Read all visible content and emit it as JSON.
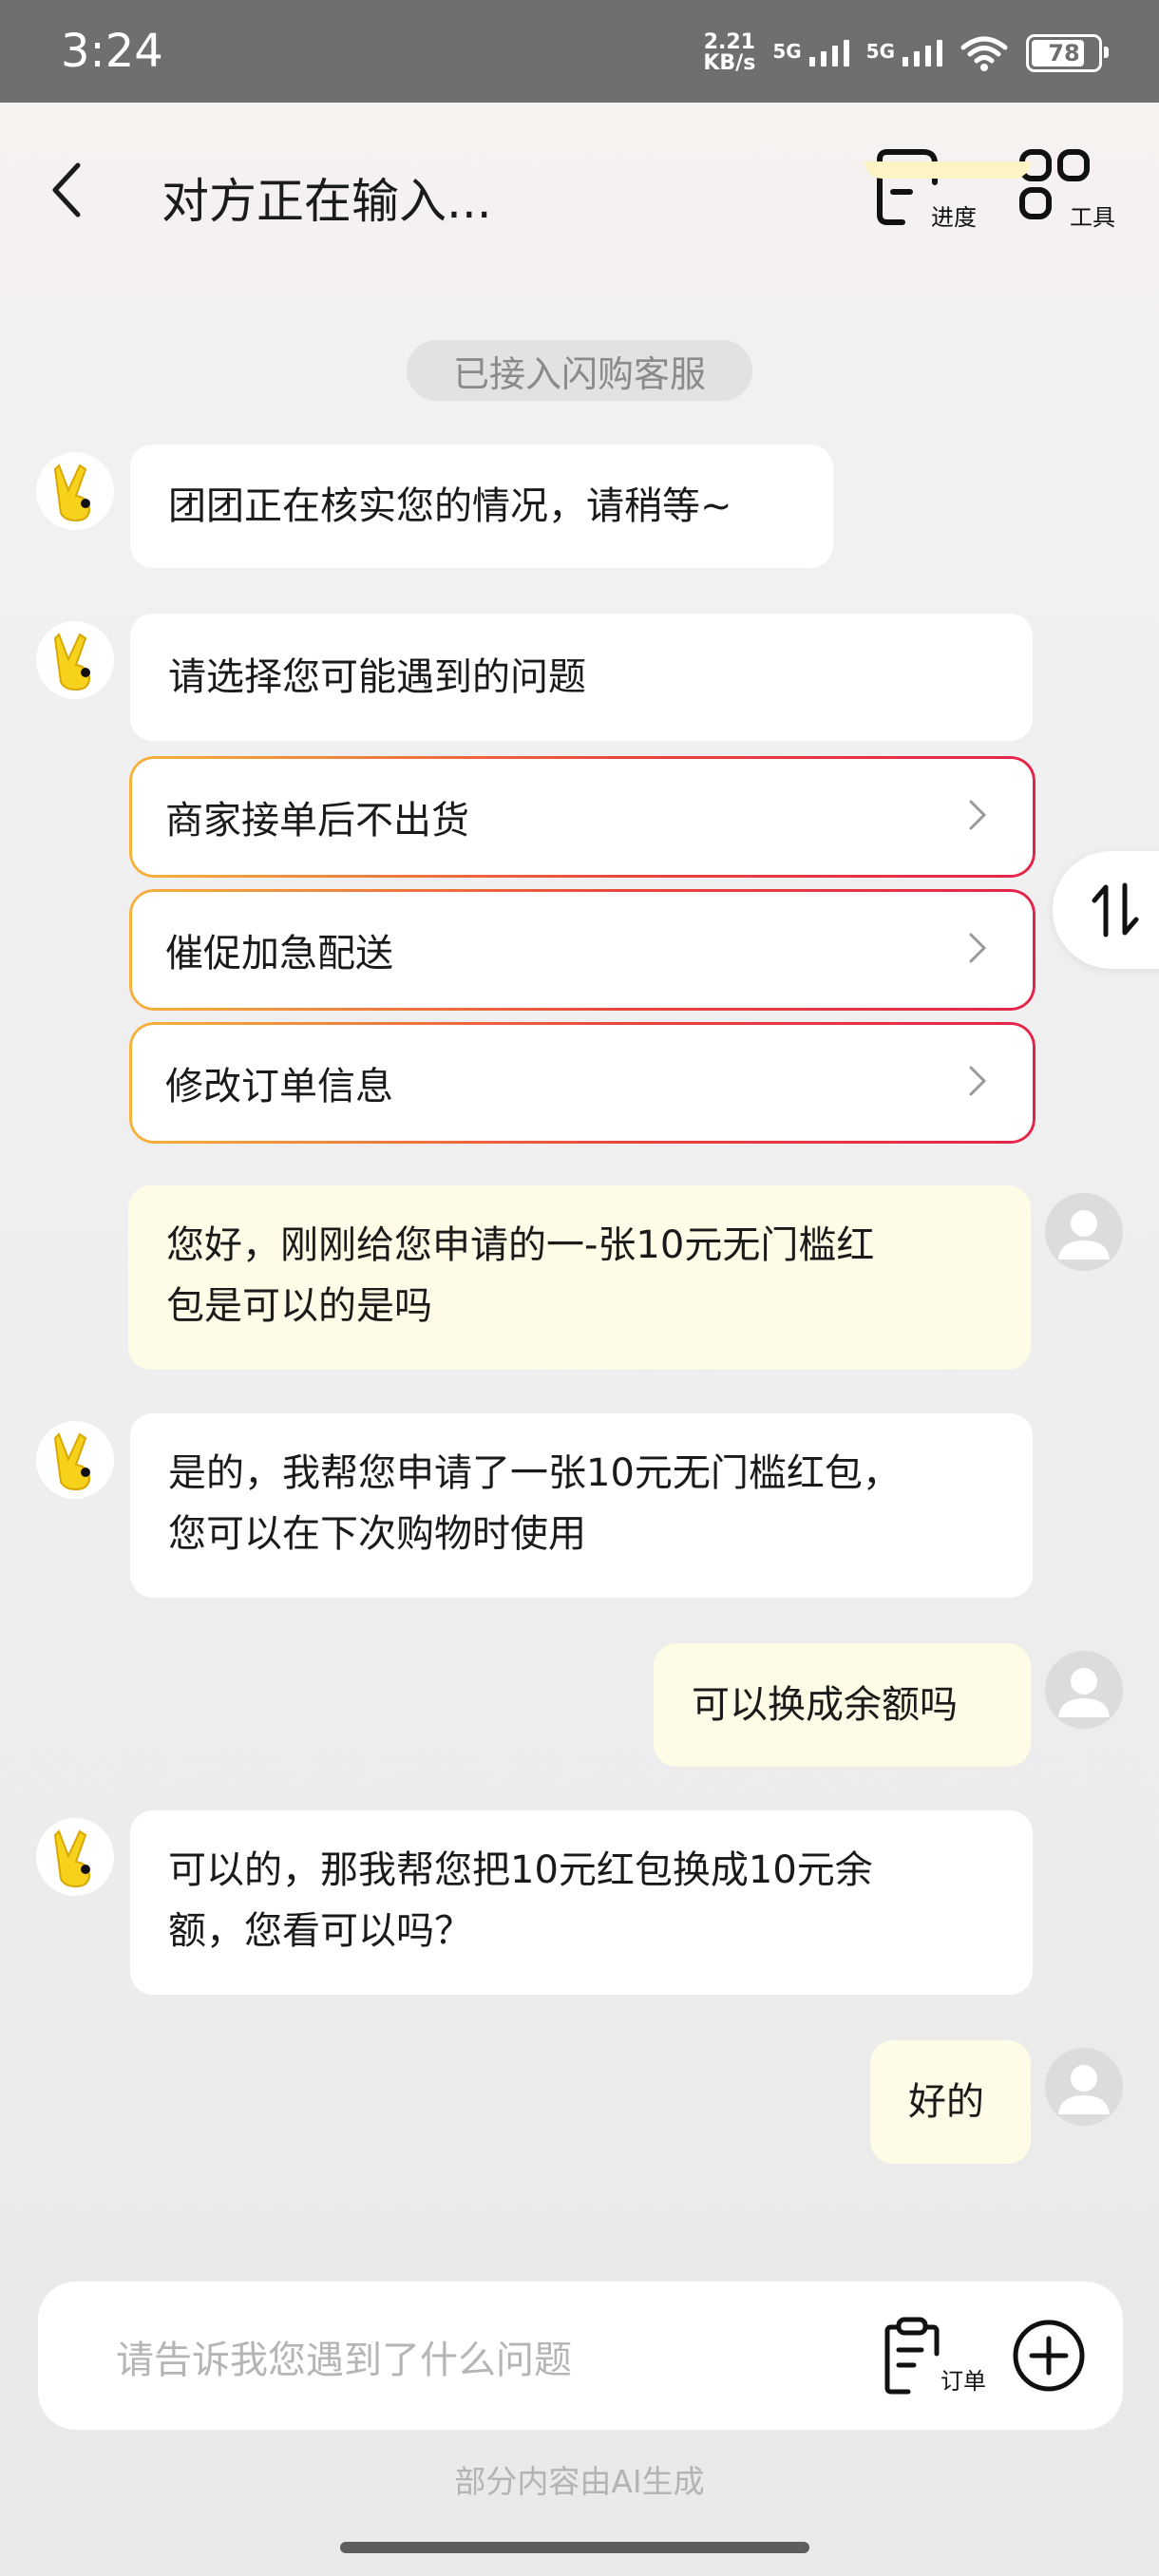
{
  "status_bar": {
    "time": "3:24",
    "speed_value": "2.21",
    "speed_unit": "KB/s",
    "sim1": "5G",
    "sim2": "5G",
    "battery": "78"
  },
  "header": {
    "title": "对方正在输入...",
    "progress_label": "进度",
    "tools_label": "工具"
  },
  "system_chip": "已接入闪购客服",
  "messages": [
    {
      "sender": "bot",
      "text": "团团正在核实您的情况，请稍等~"
    },
    {
      "sender": "bot",
      "text": "请选择您可能遇到的问题"
    },
    {
      "sender": "user",
      "lines": [
        "您好，刚刚给您申请的一-张10元无门槛红",
        "包是可以的是吗"
      ]
    },
    {
      "sender": "bot",
      "lines": [
        "是的，我帮您申请了一张10元无门槛红包，",
        "您可以在下次购物时使用"
      ]
    },
    {
      "sender": "user",
      "text": "可以换成余额吗"
    },
    {
      "sender": "bot",
      "lines": [
        "可以的，那我帮您把10元红包换成10元余",
        "额，您看可以吗？"
      ]
    },
    {
      "sender": "user",
      "text": "好的"
    }
  ],
  "options": [
    {
      "label": "商家接单后不出货"
    },
    {
      "label": "催促加急配送"
    },
    {
      "label": "修改订单信息"
    }
  ],
  "input": {
    "placeholder": "请告诉我您遇到了什么问题",
    "order_label": "订单"
  },
  "footnote": "部分内容由AI生成",
  "colors": {
    "user_bubble": "#fefbe6",
    "option_border_start": "#f6b23c",
    "option_border_end": "#e3244a",
    "status_bar": "#6f6f6f"
  },
  "icons": [
    "back-icon",
    "progress-icon",
    "tools-icon",
    "chevron-right-icon",
    "swap-order-icon",
    "order-icon",
    "plus-circle-icon",
    "bot-mascot-icon",
    "user-avatar-icon",
    "wifi-icon"
  ]
}
